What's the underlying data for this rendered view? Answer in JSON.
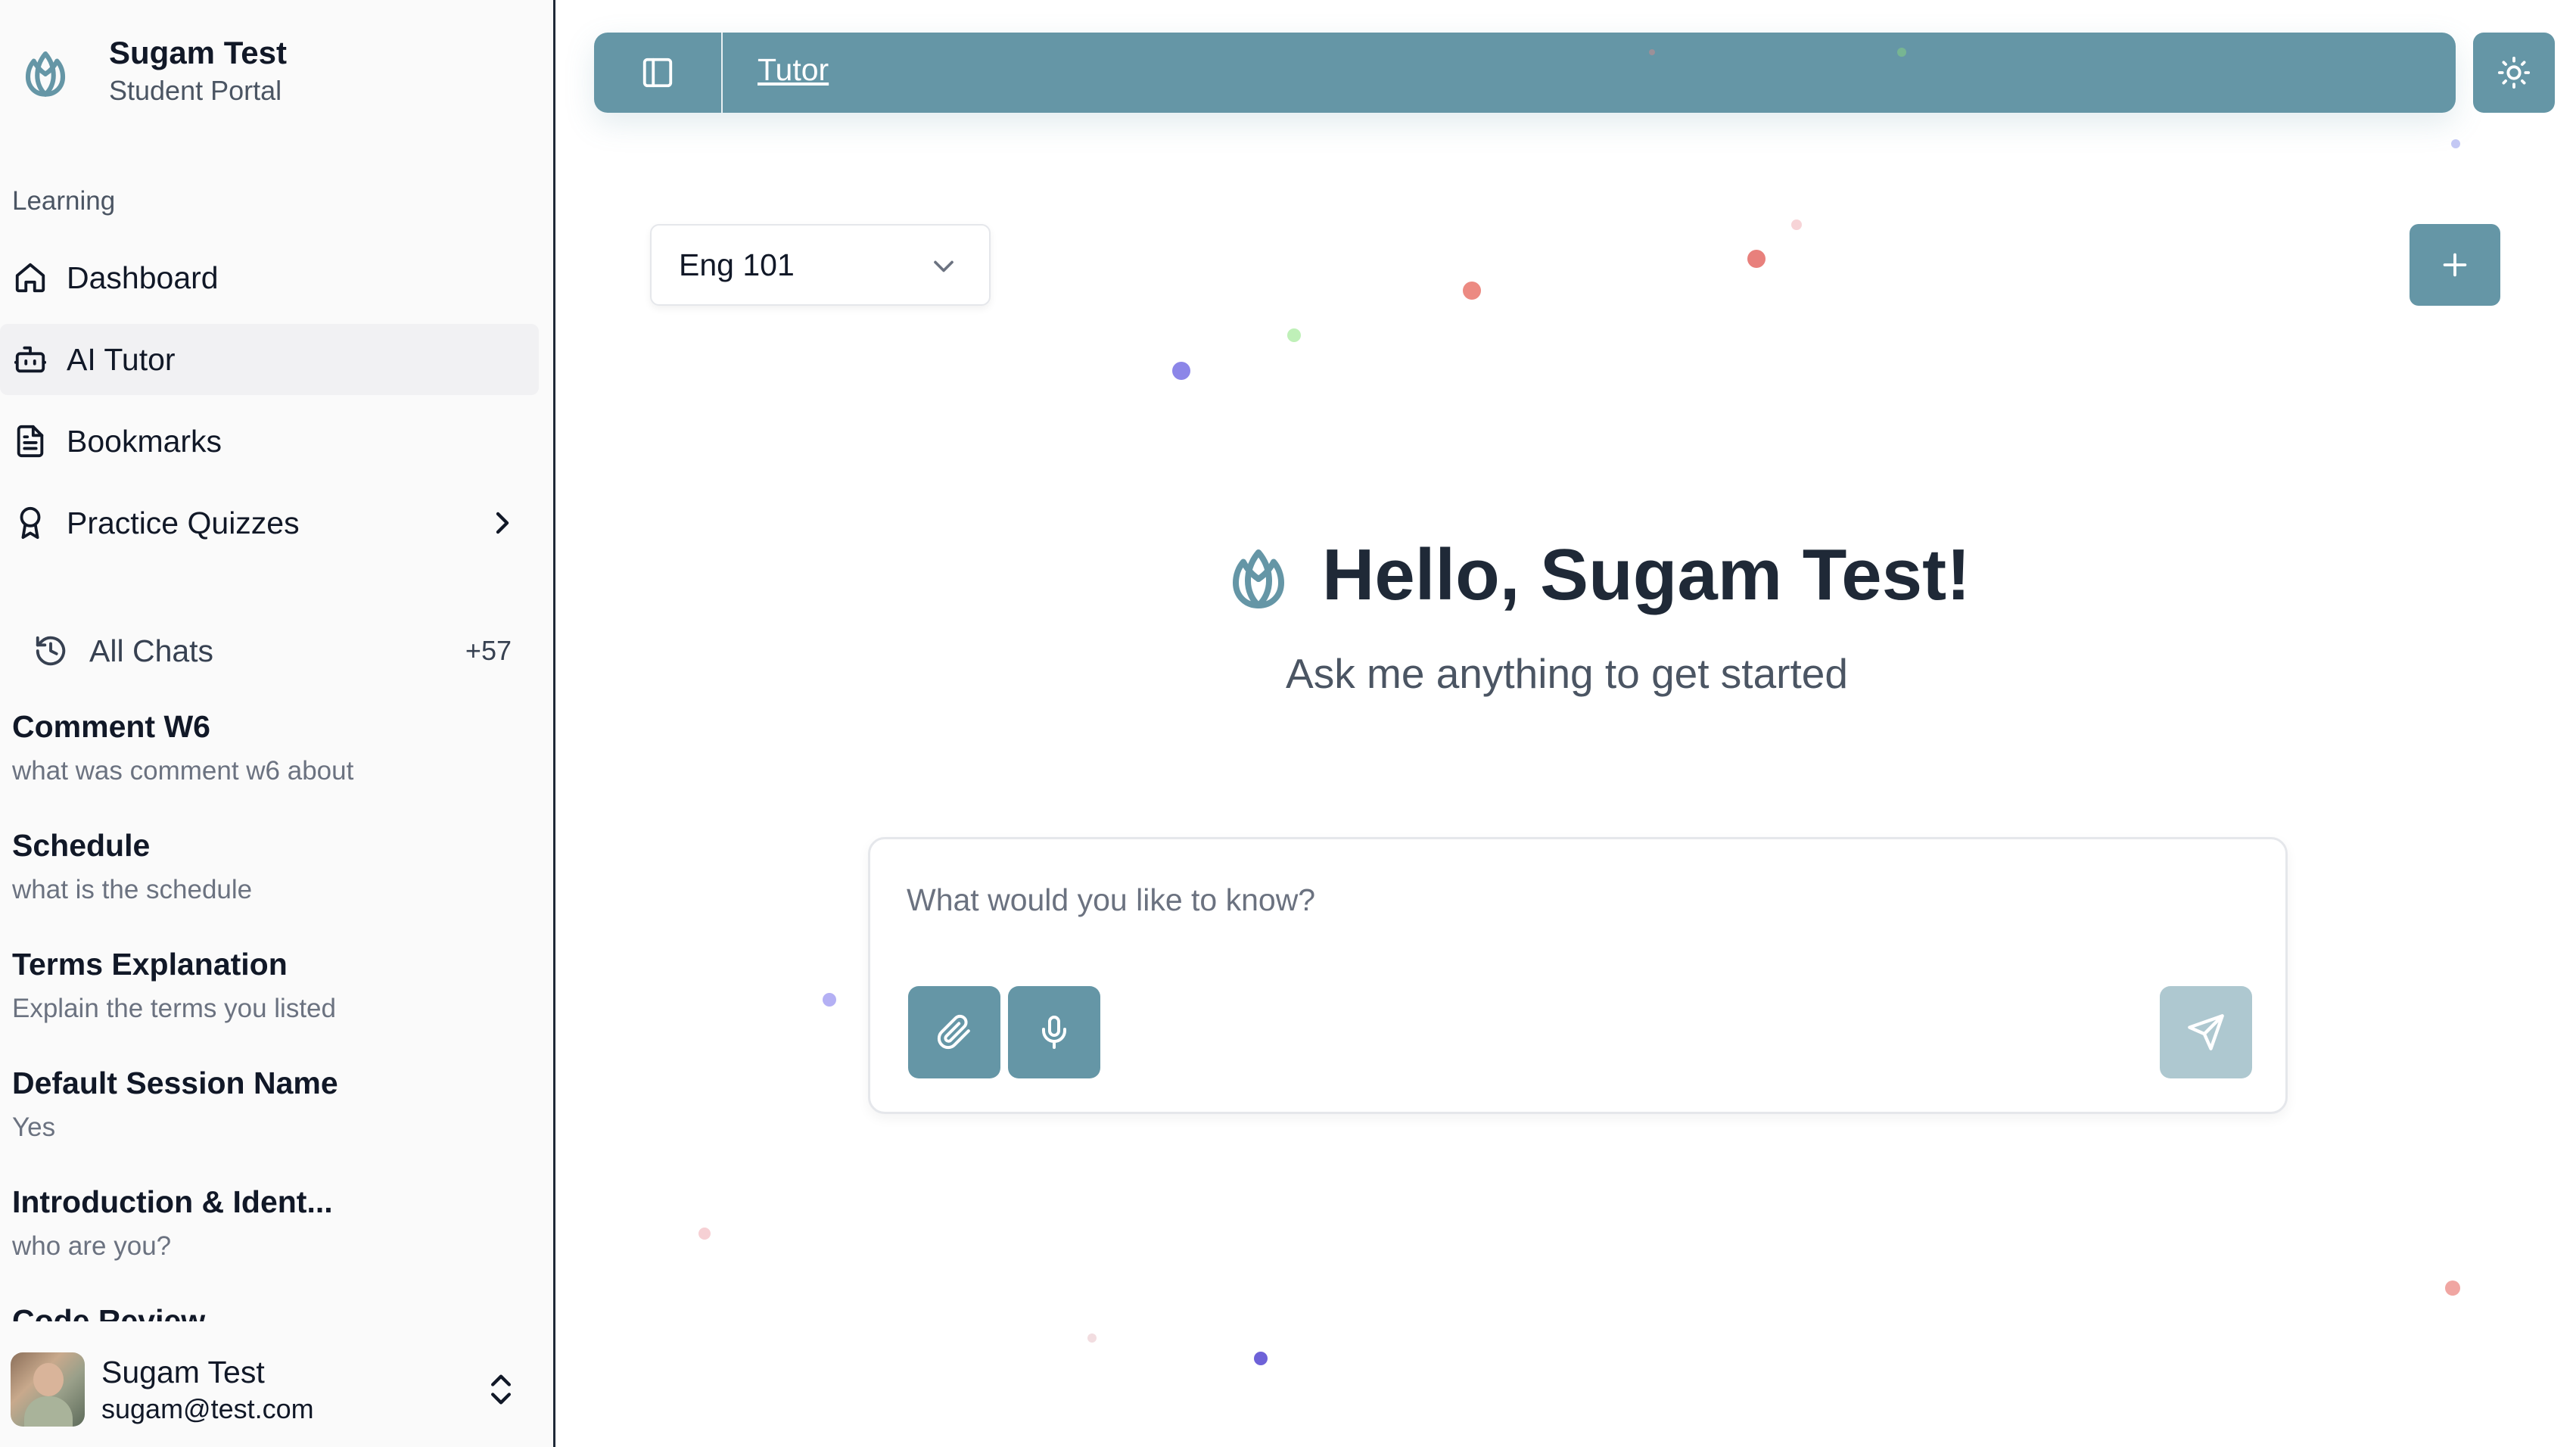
{
  "brand": {
    "name": "Sugam Test",
    "subtitle": "Student Portal"
  },
  "sidebar": {
    "section_label": "Learning",
    "nav": [
      {
        "label": "Dashboard",
        "icon": "home-icon"
      },
      {
        "label": "AI Tutor",
        "icon": "bot-icon",
        "active": true
      },
      {
        "label": "Bookmarks",
        "icon": "file-text-icon"
      },
      {
        "label": "Practice Quizzes",
        "icon": "award-icon",
        "has_submenu": true
      }
    ],
    "all_chats": {
      "label": "All Chats",
      "count": "+57",
      "icon": "history-icon"
    },
    "chats": [
      {
        "title": "Comment W6",
        "preview": "what was comment w6 about"
      },
      {
        "title": "Schedule",
        "preview": "what is the schedule"
      },
      {
        "title": "Terms Explanation",
        "preview": "Explain the terms you listed"
      },
      {
        "title": "Default Session Name",
        "preview": "Yes"
      },
      {
        "title": "Introduction & Ident...",
        "preview": "who are you?"
      },
      {
        "title": "Code Review",
        "preview": ""
      }
    ],
    "user": {
      "name": "Sugam Test",
      "email": "sugam@test.com"
    }
  },
  "topbar": {
    "breadcrumb": "Tutor"
  },
  "course_select": {
    "value": "Eng 101"
  },
  "hero": {
    "title": "Hello, Sugam Test!",
    "subtitle": "Ask me anything to get started"
  },
  "composer": {
    "placeholder": "What would you like to know?"
  },
  "colors": {
    "accent": "#6596a6",
    "accent_disabled": "#aec8d0"
  }
}
